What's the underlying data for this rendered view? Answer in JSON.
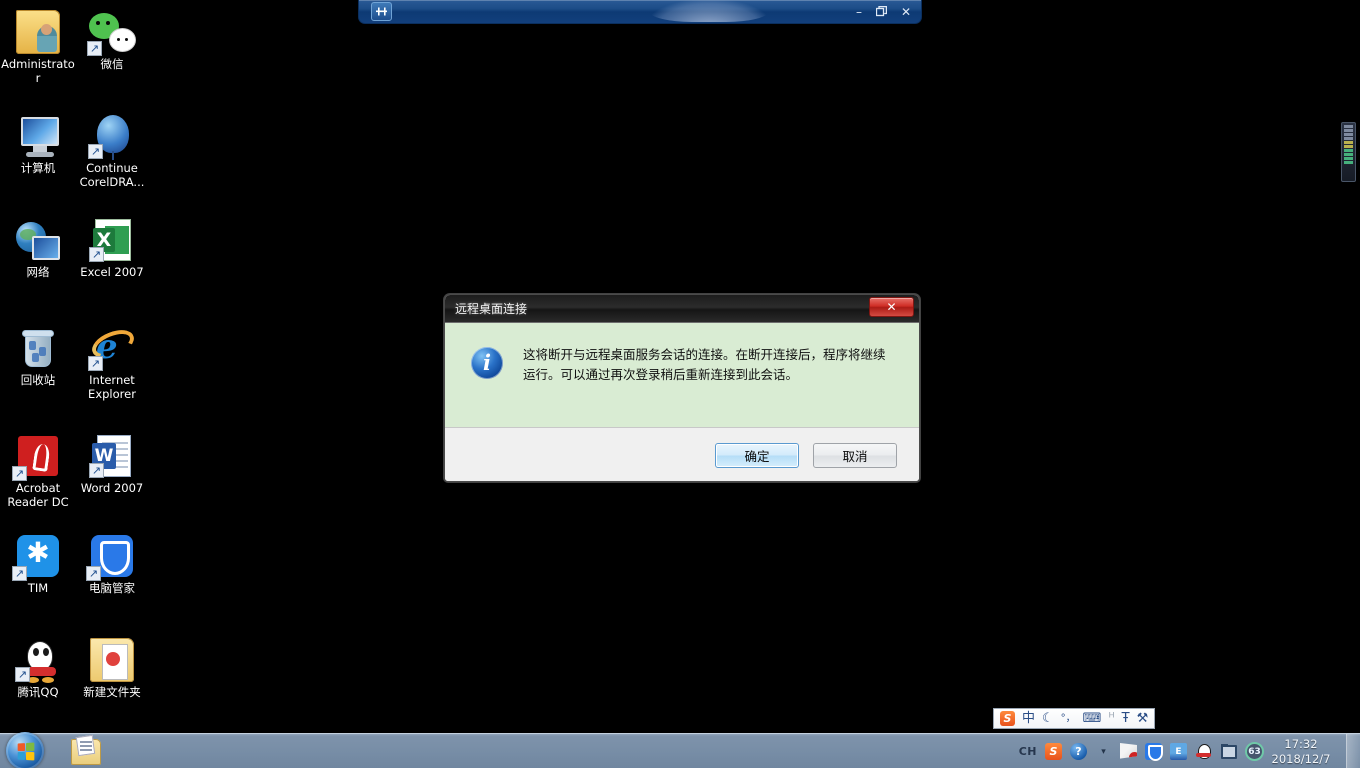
{
  "rdp_bar": {
    "pin_icon": "pushpin-icon",
    "minimize_label": "–",
    "restore_label": "❐",
    "close_label": "✕"
  },
  "desktop": {
    "background_color": "#000000",
    "icons": [
      {
        "label": "Administrator",
        "art": "folder-user",
        "shortcut": false
      },
      {
        "label": "微信",
        "art": "wechat",
        "shortcut": true
      },
      {
        "label": "计算机",
        "art": "computer",
        "shortcut": false
      },
      {
        "label": "Continue CorelDRA...",
        "art": "balloon",
        "shortcut": true
      },
      {
        "label": "网络",
        "art": "network",
        "shortcut": false
      },
      {
        "label": "Excel 2007",
        "art": "excel",
        "shortcut": true
      },
      {
        "label": "回收站",
        "art": "recycle-bin",
        "shortcut": false
      },
      {
        "label": "Internet Explorer",
        "art": "internet-explorer",
        "shortcut": true
      },
      {
        "label": "Acrobat Reader DC",
        "art": "acrobat",
        "shortcut": true
      },
      {
        "label": "Word 2007",
        "art": "word",
        "shortcut": true
      },
      {
        "label": "TIM",
        "art": "tim",
        "shortcut": true
      },
      {
        "label": "电脑管家",
        "art": "pc-manager",
        "shortcut": true
      },
      {
        "label": "腾讯QQ",
        "art": "qq",
        "shortcut": true
      },
      {
        "label": "新建文件夹",
        "art": "new-folder",
        "shortcut": false
      }
    ]
  },
  "dialog": {
    "title": "远程桌面连接",
    "close_label": "✕",
    "icon": "info-icon",
    "icon_glyph": "i",
    "message": "这将断开与远程桌面服务会话的连接。在断开连接后，程序将继续运行。可以通过再次登录稍后重新连接到此会话。",
    "ok_label": "确定",
    "cancel_label": "取消",
    "body_color": "#d9ecd3",
    "accent_color": "#b5ddf7"
  },
  "ime_bar": {
    "logo": "S",
    "items": [
      {
        "name": "chinese-mode-icon",
        "glyph": "中"
      },
      {
        "name": "moon-icon",
        "glyph": "☾"
      },
      {
        "name": "punctuation-icon",
        "glyph": "°，"
      },
      {
        "name": "soft-keyboard-icon",
        "glyph": "⌨"
      },
      {
        "name": "user-icon",
        "glyph": "ᴴ"
      },
      {
        "name": "skin-icon",
        "glyph": "Ŧ"
      },
      {
        "name": "settings-wrench-icon",
        "glyph": "⚒"
      }
    ]
  },
  "taskbar": {
    "start_button": "start-orb",
    "pinned": [
      {
        "name": "notepad-folder-icon"
      }
    ],
    "tray": {
      "language_indicator": "CH",
      "icons": [
        {
          "name": "sogou-ime-icon",
          "glyph": "S"
        },
        {
          "name": "help-icon",
          "glyph": "?"
        },
        {
          "name": "show-hidden-icons-arrow",
          "glyph": "▾"
        },
        {
          "name": "action-center-flag-icon",
          "glyph": ""
        },
        {
          "name": "tencent-pc-manager-shield-icon",
          "glyph": ""
        },
        {
          "name": "ebook-icon",
          "glyph": "E"
        },
        {
          "name": "qq-penguin-icon",
          "glyph": ""
        },
        {
          "name": "network-monitor-icon",
          "glyph": ""
        },
        {
          "name": "cpu-gauge-icon",
          "glyph": "63"
        }
      ]
    },
    "clock": {
      "time": "17:32",
      "date": "2018/12/7"
    },
    "show_desktop": "show-desktop-button"
  },
  "gadget": {
    "name": "system-meter-gadget",
    "segments": [
      "off",
      "off",
      "off",
      "off",
      "on-y",
      "on-y",
      "on-g",
      "on-g",
      "on-g",
      "on-g",
      "on-g",
      "on-g"
    ]
  }
}
